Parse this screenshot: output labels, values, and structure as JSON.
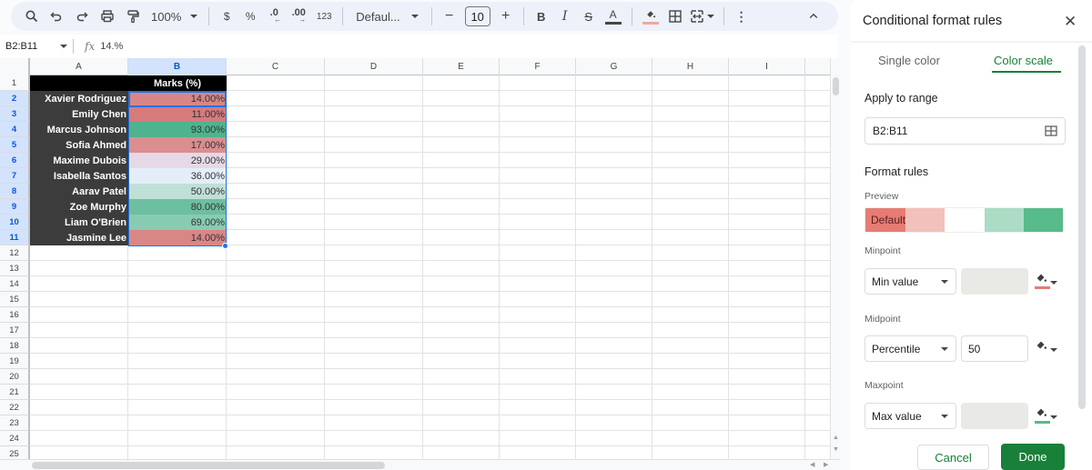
{
  "toolbar": {
    "zoom": "100%",
    "currency": "$",
    "percent": "%",
    "decrease_decimal": ".0",
    "increase_decimal": ".00",
    "more_formats": "123",
    "font": "Defaul...",
    "font_size": "10",
    "bold": "B",
    "italic": "I",
    "text_color_letter": "A",
    "text_color": "#444746",
    "fill_color": "#f4a7a0"
  },
  "formula_bar": {
    "name_box": "B2:B11",
    "fx": "fx",
    "formula": "14.%"
  },
  "sheet": {
    "columns": [
      "A",
      "B",
      "C",
      "D",
      "E",
      "F",
      "G",
      "H",
      "I"
    ],
    "selected_column": "B",
    "rows": [
      "1",
      "2",
      "3",
      "4",
      "5",
      "6",
      "7",
      "8",
      "9",
      "10",
      "11",
      "12",
      "13",
      "14",
      "15",
      "16",
      "17",
      "18",
      "19",
      "20",
      "21",
      "22",
      "23",
      "24",
      "25"
    ],
    "header_B1": "Marks (%)",
    "data": [
      {
        "name": "Xavier Rodriguez",
        "mark": "14.00%",
        "color": "#d98687"
      },
      {
        "name": "Emily Chen",
        "mark": "11.00%",
        "color": "#d77a7c"
      },
      {
        "name": "Marcus Johnson",
        "mark": "93.00%",
        "color": "#4eb38e"
      },
      {
        "name": "Sofia Ahmed",
        "mark": "17.00%",
        "color": "#da8e8f"
      },
      {
        "name": "Maxime Dubois",
        "mark": "29.00%",
        "color": "#e5d9e6"
      },
      {
        "name": "Isabella Santos",
        "mark": "36.00%",
        "color": "#e4eef8"
      },
      {
        "name": "Aarav Patel",
        "mark": "50.00%",
        "color": "#bfe0d7"
      },
      {
        "name": "Zoe Murphy",
        "mark": "80.00%",
        "color": "#6cbfa0"
      },
      {
        "name": "Liam O'Brien",
        "mark": "69.00%",
        "color": "#88cbb3"
      },
      {
        "name": "Jasmine Lee",
        "mark": "14.00%",
        "color": "#d98687"
      }
    ]
  },
  "panel": {
    "title": "Conditional format rules",
    "tabs": [
      {
        "label": "Single color",
        "active": false
      },
      {
        "label": "Color scale",
        "active": true
      }
    ],
    "apply_to_range_label": "Apply to range",
    "range": "B2:B11",
    "format_rules_label": "Format rules",
    "preview_label": "Preview",
    "preview_text": "Default",
    "preview_colors": [
      "#e67c73",
      "#f3c1bb",
      "#ffffff",
      "#acdcc5",
      "#57bb8a"
    ],
    "minpoint": {
      "label": "Minpoint",
      "type": "Min value",
      "value": "",
      "color": "#e67c73"
    },
    "midpoint": {
      "label": "Midpoint",
      "type": "Percentile",
      "value": "50",
      "color": "none"
    },
    "maxpoint": {
      "label": "Maxpoint",
      "type": "Max value",
      "value": "",
      "color": "#57bb8a"
    },
    "cancel_label": "Cancel",
    "done_label": "Done"
  }
}
